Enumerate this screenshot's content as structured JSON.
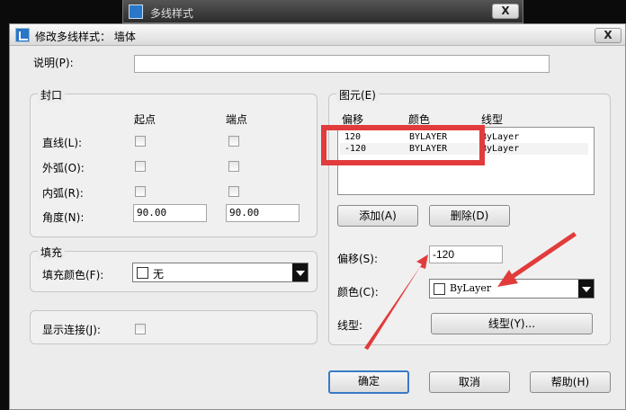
{
  "bg_window": {
    "title": "多线样式",
    "close": "X"
  },
  "dialog": {
    "title": "修改多线样式： 墙体",
    "close": "X",
    "description_label": "说明(P):",
    "description_value": "",
    "caps": {
      "group_title": "封口",
      "col_start": "起点",
      "col_end": "端点",
      "line_label": "直线(L):",
      "outer_arc_label": "外弧(O):",
      "inner_arc_label": "内弧(R):",
      "angle_label": "角度(N):",
      "angle_start": "90.00",
      "angle_end": "90.00"
    },
    "fill": {
      "group_title": "填充",
      "color_label": "填充颜色(F):",
      "color_value": "无"
    },
    "show_joints_label": "显示连接(J):",
    "elements": {
      "group_title": "图元(E)",
      "headers": [
        "偏移",
        "颜色",
        "线型"
      ],
      "rows": [
        {
          "offset": "120",
          "color": "BYLAYER",
          "linetype": "ByLayer"
        },
        {
          "offset": "-120",
          "color": "BYLAYER",
          "linetype": "ByLayer"
        }
      ],
      "add_button": "添加(A)",
      "delete_button": "删除(D)",
      "offset_label": "偏移(S):",
      "offset_value": "-120",
      "color_label": "颜色(C):",
      "color_value": "ByLayer",
      "linetype_label": "线型:",
      "linetype_button": "线型(Y)..."
    },
    "ok_button": "确定",
    "cancel_button": "取消",
    "help_button": "帮助(H)"
  },
  "colors": {
    "annotation_red": "#e23b3b",
    "default_button_border": "#3a7ac6"
  }
}
